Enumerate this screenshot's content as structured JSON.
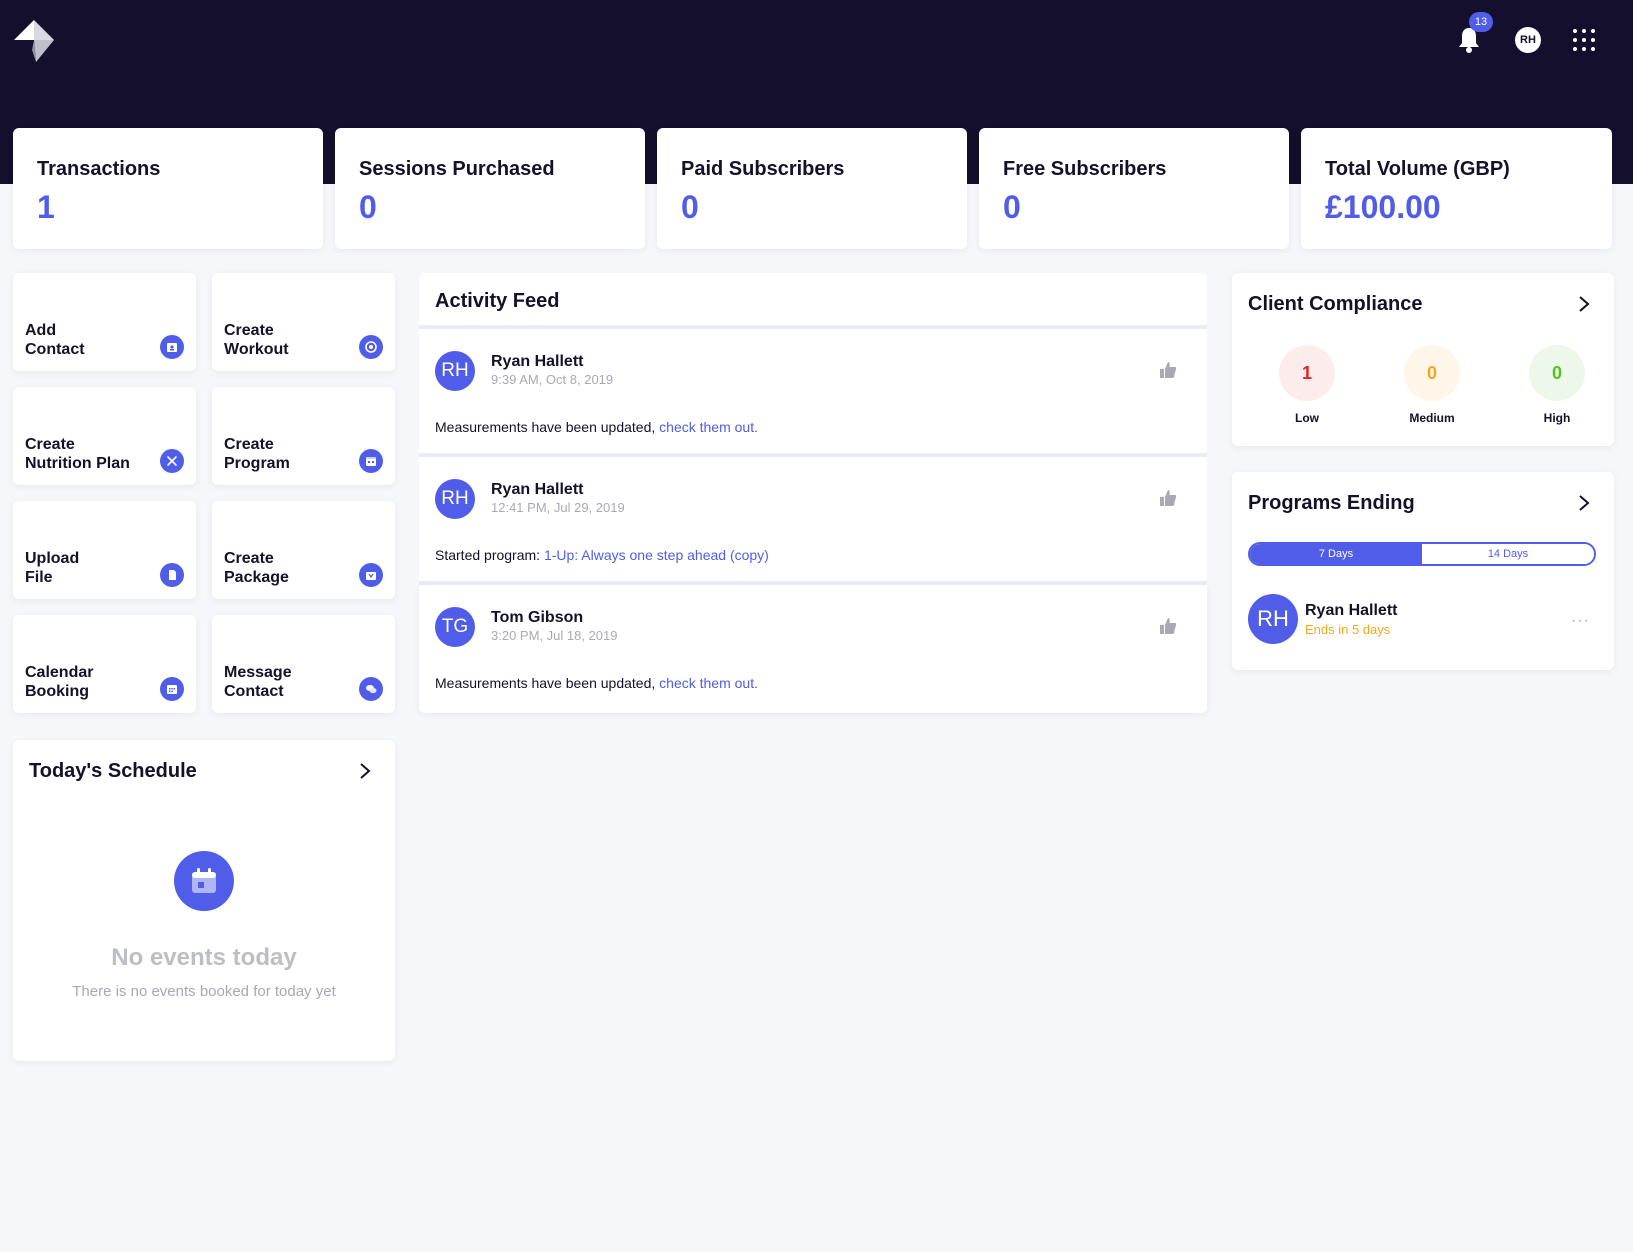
{
  "header": {
    "notification_count": "13",
    "user_initials": "RH"
  },
  "stats": [
    {
      "title": "Transactions",
      "value": "1"
    },
    {
      "title": "Sessions Purchased",
      "value": "0"
    },
    {
      "title": "Paid Subscribers",
      "value": "0"
    },
    {
      "title": "Free Subscribers",
      "value": "0"
    },
    {
      "title": "Total Volume (GBP)",
      "value": "£100.00"
    }
  ],
  "quick_actions": [
    {
      "label": "Add\nContact",
      "icon": "contact-icon"
    },
    {
      "label": "Create\nWorkout",
      "icon": "workout-icon"
    },
    {
      "label": "Create\nNutrition Plan",
      "icon": "cutlery-icon"
    },
    {
      "label": "Create\nProgram",
      "icon": "calendar-icon"
    },
    {
      "label": "Upload\nFile",
      "icon": "file-icon"
    },
    {
      "label": "Create\nPackage",
      "icon": "package-icon"
    },
    {
      "label": "Calendar\nBooking",
      "icon": "calendar-icon"
    },
    {
      "label": "Message\nContact",
      "icon": "chat-icon"
    }
  ],
  "schedule": {
    "title": "Today's Schedule",
    "empty_title": "No events today",
    "empty_text": "There is no events booked for today yet"
  },
  "activity_feed": {
    "title": "Activity Feed",
    "items": [
      {
        "initials": "RH",
        "name": "Ryan Hallett",
        "time": "9:39 AM, Oct 8, 2019",
        "text": "Measurements have been updated, ",
        "link": "check them out."
      },
      {
        "initials": "RH",
        "name": "Ryan Hallett",
        "time": "12:41 PM, Jul 29, 2019",
        "text": "Started program: ",
        "link": "1-Up: Always one step ahead (copy)"
      },
      {
        "initials": "TG",
        "name": "Tom Gibson",
        "time": "3:20 PM, Jul 18, 2019",
        "text": "Measurements have been updated, ",
        "link": "check them out."
      }
    ]
  },
  "compliance": {
    "title": "Client Compliance",
    "levels": [
      {
        "label": "Low",
        "value": "1",
        "color": "#e02424",
        "bg": "#fdecec"
      },
      {
        "label": "Medium",
        "value": "0",
        "color": "#f2a81d",
        "bg": "#fef6e8"
      },
      {
        "label": "High",
        "value": "0",
        "color": "#52c41a",
        "bg": "#eef8ea"
      }
    ]
  },
  "programs_ending": {
    "title": "Programs Ending",
    "tabs": [
      "7 Days",
      "14 Days"
    ],
    "active_tab": "7 Days",
    "items": [
      {
        "initials": "RH",
        "name": "Ryan Hallett",
        "ends": "Ends in 5 days"
      }
    ]
  },
  "colors": {
    "accent": "#4f5de8",
    "header_bg": "#140f2d",
    "page_bg": "#f6f7fb"
  }
}
